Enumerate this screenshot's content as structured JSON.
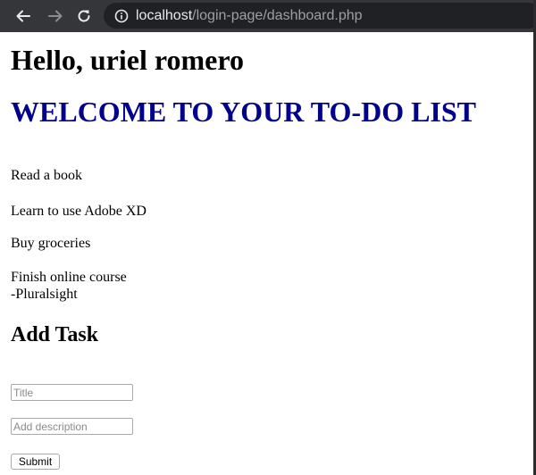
{
  "browser": {
    "url_host": "localhost",
    "url_path": "/login-page/dashboard.php"
  },
  "page": {
    "greeting": "Hello, uriel romero",
    "welcome_heading": "WELCOME TO YOUR TO-DO LIST",
    "tasks": [
      {
        "title": "Read a book"
      },
      {
        "title": "Learn to use Adobe XD"
      },
      {
        "title": "Buy groceries"
      },
      {
        "title": "Finish online course",
        "subtitle": "-Pluralsight"
      }
    ],
    "add_task_heading": "Add Task",
    "title_placeholder": "Title",
    "description_placeholder": "Add description",
    "submit_label": "Submit"
  },
  "colors": {
    "toolbar": "#35363a",
    "omnibox": "#202124",
    "welcome_heading": "#00008b"
  }
}
